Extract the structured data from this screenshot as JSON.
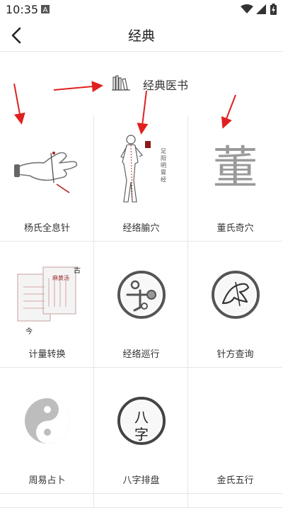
{
  "status": {
    "time": "10:35"
  },
  "header": {
    "title": "经典"
  },
  "section": {
    "label": "经典医书"
  },
  "items": [
    {
      "label": "杨氏全息针"
    },
    {
      "label": "经络腧穴",
      "seal_text": "足阳明胃经"
    },
    {
      "label": "董氏奇穴",
      "glyph": "董"
    },
    {
      "label": "计量转换",
      "doc_title": "麻黄汤",
      "tag_old": "古",
      "tag_new": "今"
    },
    {
      "label": "经络巡行"
    },
    {
      "label": "针方查询"
    },
    {
      "label": "周易占卜"
    },
    {
      "label": "八字排盘",
      "glyph": "八字"
    },
    {
      "label": "金氏五行"
    }
  ],
  "colors": {
    "accent_arrow": "#e02020",
    "grid_line": "#e6e6e6",
    "icon_gray": "#9a9a9a"
  }
}
